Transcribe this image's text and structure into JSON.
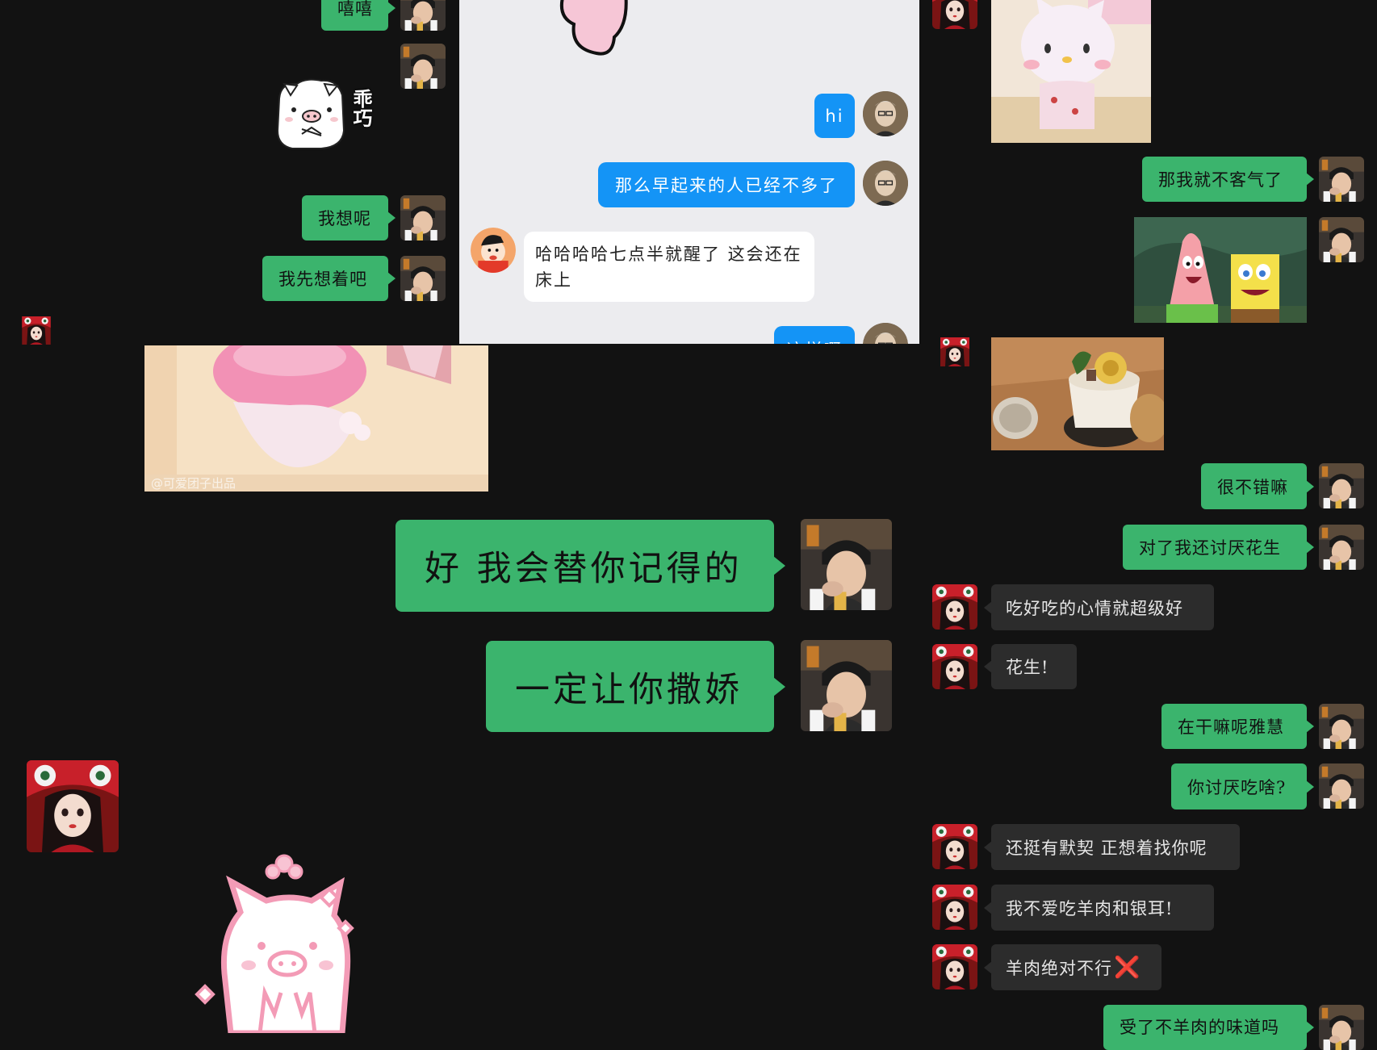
{
  "colors": {
    "background": "#121212",
    "sent_bubble": "#3bb46d",
    "received_bubble": "#2c2c2c",
    "screenshot_bg": "#ececef",
    "blue_bubble": "#1494f6"
  },
  "left_column": {
    "messages": [
      "嘻嘻",
      "我想呢",
      "我先想着吧"
    ],
    "sticker_caption": "乖巧"
  },
  "inner_screenshot": {
    "messages_sent": [
      "hi",
      "那么早起来的人已经不多了",
      "这样啊"
    ],
    "message_received": "哈哈哈哈七点半就醒了 这会还在床上"
  },
  "center": {
    "big_messages": [
      "好 我会替你记得的",
      "一定让你撒娇"
    ],
    "video_watermark": "@可爱团子出品"
  },
  "right_column": {
    "sent": [
      "那我就不客气了",
      "很不错嘛",
      "对了我还讨厌花生",
      "在干嘛呢雅慧",
      "你讨厌吃啥?",
      "受了不羊肉的味道吗"
    ],
    "received": [
      "吃好吃的心情就超级好",
      "花生!",
      "还挺有默契 正想着找你呢",
      "我不爱吃羊肉和银耳!",
      "羊肉绝对不行"
    ],
    "received_emoji": "❌"
  }
}
